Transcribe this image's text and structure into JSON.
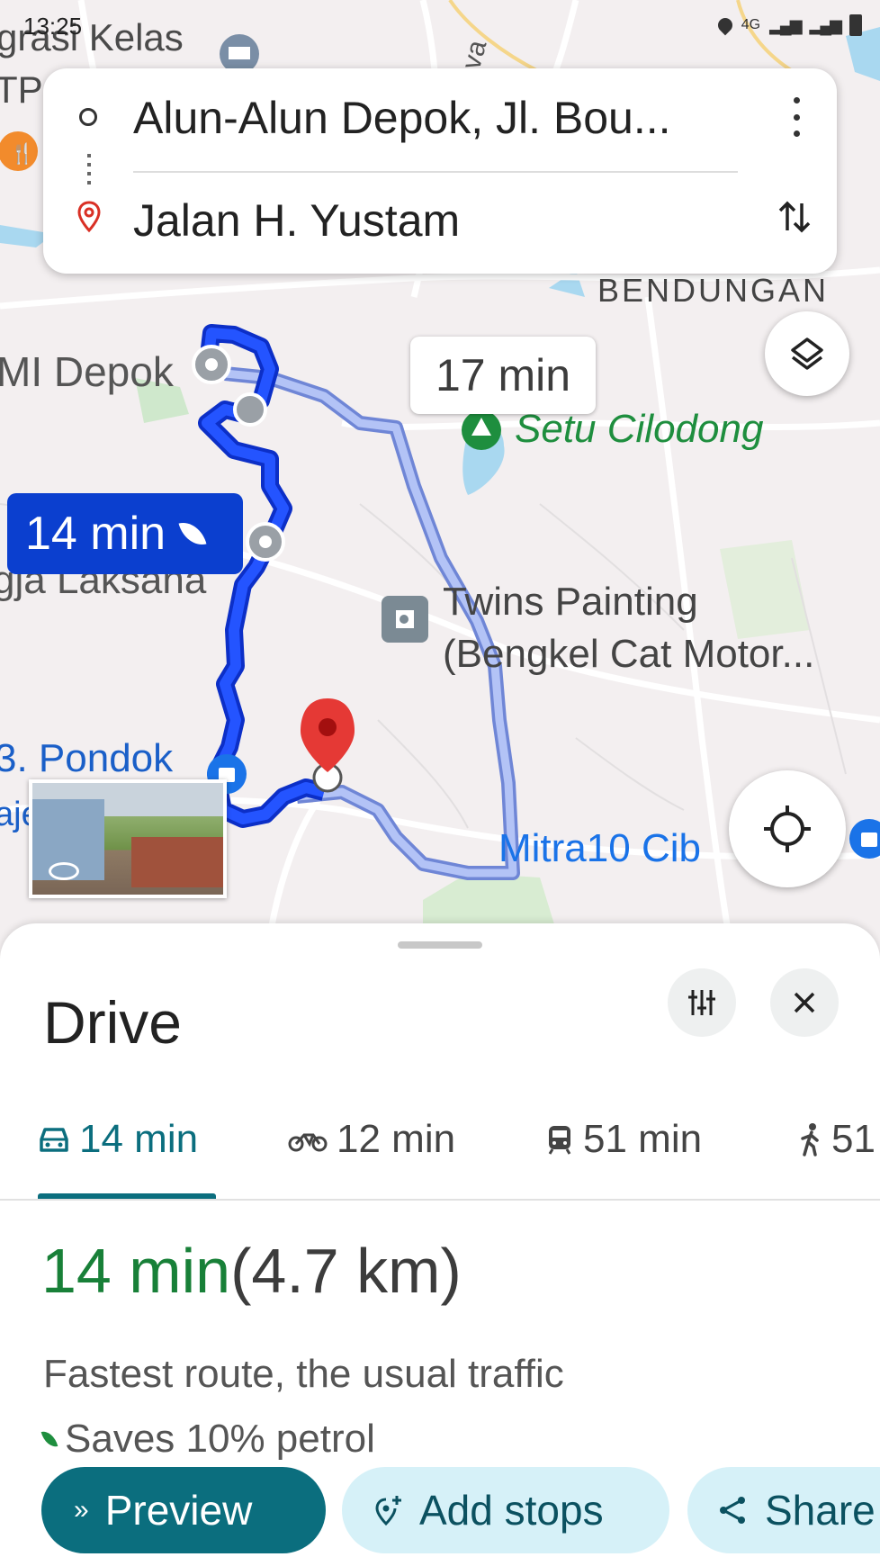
{
  "status_bar": {
    "time": "13:25",
    "network": "4G"
  },
  "directions": {
    "origin": "Alun-Alun Depok, Jl. Bou...",
    "destination": "Jalan H. Yustam"
  },
  "map": {
    "labels": {
      "top_left": "grasi Kelas",
      "top_left2": "TP",
      "bendungan": "BENDUNGAN",
      "mi_depok": "MI Depok",
      "setu": "Setu Cilodong",
      "laksana": "gja Laksana",
      "twins1": "Twins Painting",
      "twins2": "(Bengkel Cat Motor...",
      "pondok": "3. Pondok",
      "pondok2": "aje",
      "mitra": "Mitra10 Cib",
      "road_va": "va"
    },
    "route_alt_time": "17 min",
    "route_main_time": "14 min",
    "colors": {
      "route_main": "#1a3be8",
      "route_alt": "#aebcf5",
      "pin": "#e53935"
    }
  },
  "sheet": {
    "title": "Drive",
    "modes": [
      {
        "icon": "car-icon",
        "label": "14 min"
      },
      {
        "icon": "motorbike-icon",
        "label": "12 min"
      },
      {
        "icon": "transit-icon",
        "label": "51 min"
      },
      {
        "icon": "walk-icon",
        "label": "51"
      }
    ],
    "summary_time": "14 min",
    "summary_distance": "(4.7 km)",
    "description": "Fastest route, the usual traffic",
    "eco_note": "Saves 10% petrol",
    "actions": {
      "preview": "Preview",
      "add_stops": "Add stops",
      "share": "Share"
    }
  }
}
